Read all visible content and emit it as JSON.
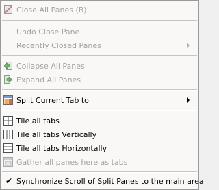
{
  "menu": {
    "items": [
      {
        "label": "Close All Panes (B)",
        "disabled": true,
        "icon": "close-all-panes-icon"
      },
      {
        "label": "Undo Close Pane",
        "disabled": true
      },
      {
        "label": "Recently Closed Panes",
        "disabled": true,
        "submenu": true
      },
      {
        "label": "Collapse All Panes",
        "disabled": true,
        "icon": "collapse-panes-icon"
      },
      {
        "label": "Expand All Panes",
        "disabled": true,
        "icon": "expand-panes-icon"
      },
      {
        "label": "Split Current Tab to",
        "disabled": false,
        "submenu": true,
        "icon": "split-tab-icon"
      },
      {
        "label": "Tile all tabs",
        "disabled": false,
        "icon": "tile-all-icon"
      },
      {
        "label": "Tile all tabs Vertically",
        "disabled": false,
        "icon": "tile-vertical-icon"
      },
      {
        "label": "Tile all tabs Horizontally",
        "disabled": false,
        "icon": "tile-horizontal-icon"
      },
      {
        "label": "Gather all panes here as tabs",
        "disabled": true,
        "icon": "gather-panes-icon"
      },
      {
        "label": "Synchronize Scroll of Split Panes to the main area",
        "disabled": false,
        "checked": true,
        "icon": "checkmark-icon"
      }
    ],
    "colors": {
      "text": "#000000",
      "disabled_text": "#a3a3a3",
      "background": "#f9f8f6"
    }
  }
}
